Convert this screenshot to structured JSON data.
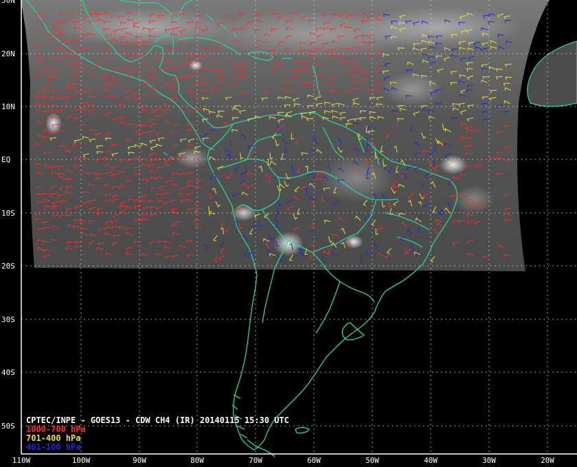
{
  "title": "CPTEC/INPE - GOES13 - CDW CH4 (IR) 20140115 15:30 UTC",
  "legend": [
    {
      "label": "1000-700 hPa",
      "color": "#ff2b2b"
    },
    {
      "label": "701-400 hPa",
      "color": "#e8e23a"
    },
    {
      "label": "401-100 hPa",
      "color": "#1e28d8"
    }
  ],
  "lat_labels": [
    "30N",
    "20N",
    "10N",
    "EQ",
    "10S",
    "20S",
    "30S",
    "40S",
    "50S"
  ],
  "lon_labels": [
    "110W",
    "100W",
    "90W",
    "80W",
    "70W",
    "60W",
    "50W",
    "40W",
    "30W",
    "20W"
  ],
  "colors": {
    "coastline": "#22d8a0",
    "grid": "#d0d0d0",
    "background": "#000000",
    "satellite": "#5a5a5a"
  }
}
